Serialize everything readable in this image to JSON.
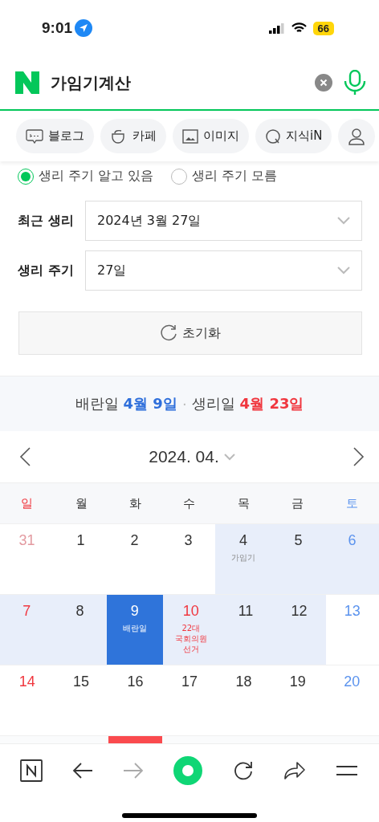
{
  "status_bar": {
    "time": "9:01",
    "battery": "66"
  },
  "search": {
    "value": "가임기계산"
  },
  "chips": [
    {
      "label": "블로그",
      "kind": "blog"
    },
    {
      "label": "카페",
      "kind": "cafe"
    },
    {
      "label": "이미지",
      "kind": "image"
    },
    {
      "label": "지식iN",
      "kind": "kin"
    },
    {
      "kind": "person"
    }
  ],
  "mode_options": [
    {
      "label": "생리 주기 알고 있음",
      "selected": true
    },
    {
      "label": "생리 주기 모름",
      "selected": false
    }
  ],
  "fields": [
    {
      "label": "최근 생리",
      "value": "2024년 3월 27일"
    },
    {
      "label": "생리 주기",
      "value": "27일"
    }
  ],
  "reset_button": "초기화",
  "summary": {
    "ovulation_label": "배란일",
    "ovulation_date": "4월 9일",
    "separator": "·",
    "period_label": "생리일",
    "period_date": "4월 23일"
  },
  "calendar": {
    "month": "2024. 04.",
    "weekdays": [
      {
        "label": "일",
        "kind": "sunday"
      },
      {
        "label": "월",
        "kind": "weekday"
      },
      {
        "label": "화",
        "kind": "weekday"
      },
      {
        "label": "수",
        "kind": "weekday"
      },
      {
        "label": "목",
        "kind": "weekday"
      },
      {
        "label": "금",
        "kind": "weekday"
      },
      {
        "label": "토",
        "kind": "saturday"
      }
    ],
    "weeks": [
      [
        {
          "day": "31",
          "kind": "other_month",
          "fertile": false,
          "selected": false
        },
        {
          "day": "1",
          "kind": "weekday",
          "fertile": false,
          "selected": false
        },
        {
          "day": "2",
          "kind": "weekday",
          "fertile": false,
          "selected": false
        },
        {
          "day": "3",
          "kind": "weekday",
          "fertile": false,
          "selected": false
        },
        {
          "day": "4",
          "kind": "weekday",
          "fertile": true,
          "selected": false,
          "note": "가임기"
        },
        {
          "day": "5",
          "kind": "weekday",
          "fertile": true,
          "selected": false
        },
        {
          "day": "6",
          "kind": "saturday",
          "fertile": true,
          "selected": false
        }
      ],
      [
        {
          "day": "7",
          "kind": "sunday",
          "fertile": true,
          "selected": false
        },
        {
          "day": "8",
          "kind": "weekday",
          "fertile": true,
          "selected": false
        },
        {
          "day": "9",
          "kind": "weekday",
          "selected": true,
          "note": "배란일"
        },
        {
          "day": "10",
          "kind": "holiday",
          "fertile": true,
          "selected": false,
          "note": "22대 국회의원 선거"
        },
        {
          "day": "11",
          "kind": "weekday",
          "fertile": true,
          "selected": false
        },
        {
          "day": "12",
          "kind": "weekday",
          "fertile": true,
          "selected": false
        },
        {
          "day": "13",
          "kind": "saturday",
          "fertile": false,
          "selected": false
        }
      ],
      [
        {
          "day": "14",
          "kind": "sunday",
          "fertile": false,
          "selected": false
        },
        {
          "day": "15",
          "kind": "weekday",
          "fertile": false,
          "selected": false
        },
        {
          "day": "16",
          "kind": "weekday",
          "fertile": false,
          "selected": false
        },
        {
          "day": "17",
          "kind": "weekday",
          "fertile": false,
          "selected": false
        },
        {
          "day": "18",
          "kind": "weekday",
          "fertile": false,
          "selected": false
        },
        {
          "day": "19",
          "kind": "weekday",
          "fertile": false,
          "selected": false
        },
        {
          "day": "20",
          "kind": "saturday",
          "fertile": false,
          "selected": false
        }
      ]
    ],
    "next_week_period": [
      false,
      false,
      true,
      false,
      false,
      false,
      false
    ]
  },
  "bottom_bar": [
    {
      "kind": "home"
    },
    {
      "kind": "back",
      "disabled": false
    },
    {
      "kind": "forward",
      "disabled": true
    },
    {
      "kind": "green"
    },
    {
      "kind": "reload"
    },
    {
      "kind": "share"
    },
    {
      "kind": "menu"
    }
  ]
}
